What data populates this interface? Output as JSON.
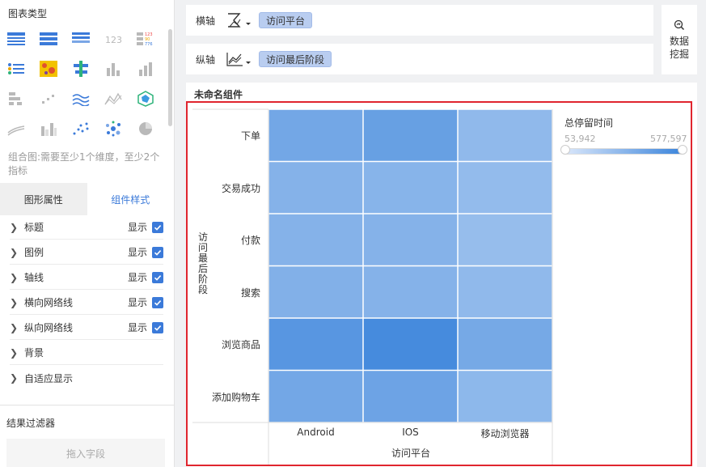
{
  "left_panel": {
    "chart_type_title": "图表类型",
    "hint": "组合图:需要至少1个维度，至少2个指标",
    "tabs": [
      "图形属性",
      "组件样式"
    ],
    "properties": [
      {
        "label": "标题",
        "show": "显示"
      },
      {
        "label": "图例",
        "show": "显示"
      },
      {
        "label": "轴线",
        "show": "显示"
      },
      {
        "label": "横向网络线",
        "show": "显示"
      },
      {
        "label": "纵向网络线",
        "show": "显示"
      },
      {
        "label": "背景",
        "show": ""
      },
      {
        "label": "自适应显示",
        "show": ""
      }
    ],
    "filter_title": "结果过滤器",
    "drop_placeholder": "拖入字段",
    "chart_type_icons": [
      "table-icon",
      "cross-table-icon",
      "detail-table-icon",
      "number-icon",
      "color-table-icon",
      "kpi-icon",
      "heatmap-icon",
      "grouped-table-icon",
      "bar-icon",
      "bar-stack-icon",
      "multi-row-icon",
      "scatter-small-icon",
      "line-multi-icon",
      "area-icon",
      "radar-icon",
      "line-area-icon",
      "bar-compare-icon",
      "scatter-icon",
      "bubble-icon",
      "pie-icon"
    ]
  },
  "axis": {
    "x_label": "横轴",
    "x_field": "访问平台",
    "y_label": "纵轴",
    "y_field": "访问最后阶段"
  },
  "mining_button": [
    "数据",
    "挖掘"
  ],
  "component": {
    "title": "未命名组件",
    "legend": {
      "title": "总停留时间",
      "min": "53,942",
      "max": "577,597"
    }
  },
  "chart_data": {
    "type": "heatmap",
    "xlabel": "访问平台",
    "ylabel": "访问最后阶段",
    "x": [
      "Android",
      "IOS",
      "移动浏览器"
    ],
    "y": [
      "下单",
      "交易成功",
      "付款",
      "搜索",
      "浏览商品",
      "添加购物车"
    ],
    "values": [
      [
        0.62,
        0.7,
        0.42
      ],
      [
        0.5,
        0.48,
        0.4
      ],
      [
        0.5,
        0.5,
        0.38
      ],
      [
        0.52,
        0.5,
        0.42
      ],
      [
        0.8,
        0.92,
        0.6
      ],
      [
        0.62,
        0.66,
        0.44
      ]
    ],
    "colors": {
      "low": "#cfe0f7",
      "high": "#3a84db"
    },
    "legend": {
      "title": "总停留时间",
      "min": 53942,
      "max": 577597
    }
  }
}
